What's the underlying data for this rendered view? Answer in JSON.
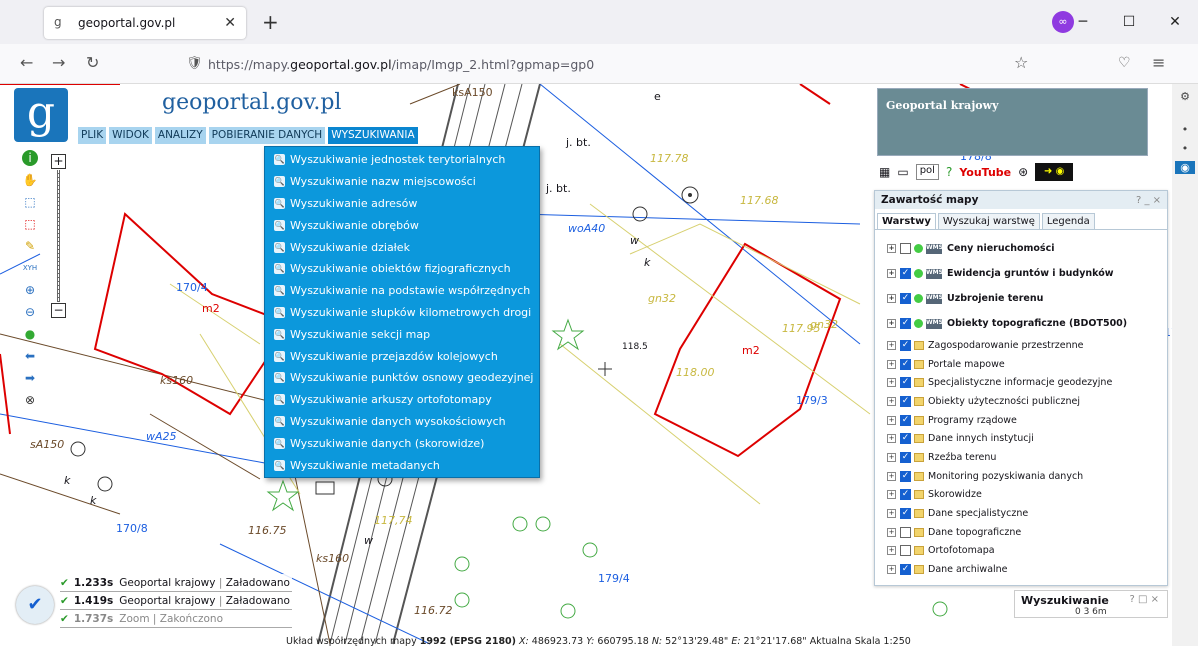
{
  "browser": {
    "tab_title": "geoportal.gov.pl",
    "url_prefix": "https://mapy.",
    "url_domain": "geoportal.gov.pl",
    "url_rest": "/imap/Imgp_2.html?gpmap=gp0"
  },
  "site": {
    "brand": "geoportal.gov.pl"
  },
  "menu": [
    "PLIK",
    "WIDOK",
    "ANALIZY",
    "POBIERANIE DANYCH",
    "WYSZUKIWANIA"
  ],
  "dropdown": [
    "Wyszukiwanie jednostek terytorialnych",
    "Wyszukiwanie nazw miejscowości",
    "Wyszukiwanie adresów",
    "Wyszukiwanie obrębów",
    "Wyszukiwanie działek",
    "Wyszukiwanie obiektów fizjograficznych",
    "Wyszukiwanie na podstawie współrzędnych",
    "Wyszukiwanie słupków kilometrowych drogi",
    "Wyszukiwanie sekcji map",
    "Wyszukiwanie przejazdów kolejowych",
    "Wyszukiwanie punktów osnowy geodezyjnej",
    "Wyszukiwanie arkuszy ortofotomapy",
    "Wyszukiwanie danych wysokościowych",
    "Wyszukiwanie danych (skorowidze)",
    "Wyszukiwanie metadanych"
  ],
  "rightpanel": {
    "overview_title": "Geoportal krajowy",
    "lang": "pol",
    "youtube": "YouTube"
  },
  "content": {
    "title": "Zawartość mapy",
    "controls": "? _ ×",
    "tabs": [
      "Warstwy",
      "Wyszukaj warstwę",
      "Legenda"
    ],
    "layers": [
      {
        "name": "Ceny nieruchomości",
        "on": false,
        "kind": "service"
      },
      {
        "name": "Ewidencja gruntów i budynków",
        "on": true,
        "kind": "service"
      },
      {
        "name": "Uzbrojenie terenu",
        "on": true,
        "kind": "service"
      },
      {
        "name": "Obiekty topograficzne (BDOT500)",
        "on": true,
        "kind": "service"
      },
      {
        "name": "Zagospodarowanie przestrzenne",
        "on": true,
        "kind": "folder"
      },
      {
        "name": "Portale mapowe",
        "on": true,
        "kind": "folder"
      },
      {
        "name": "Specjalistyczne informacje geodezyjne",
        "on": true,
        "kind": "folder"
      },
      {
        "name": "Obiekty użyteczności publicznej",
        "on": true,
        "kind": "folder"
      },
      {
        "name": "Programy rządowe",
        "on": true,
        "kind": "folder"
      },
      {
        "name": "Dane innych instytucji",
        "on": true,
        "kind": "folder"
      },
      {
        "name": "Rzeźba terenu",
        "on": true,
        "kind": "folder"
      },
      {
        "name": "Monitoring pozyskiwania danych",
        "on": true,
        "kind": "folder"
      },
      {
        "name": "Skorowidze",
        "on": true,
        "kind": "folder"
      },
      {
        "name": "Dane specjalistyczne",
        "on": true,
        "kind": "folder"
      },
      {
        "name": "Dane topograficzne",
        "on": false,
        "kind": "folder"
      },
      {
        "name": "Ortofotomapa",
        "on": false,
        "kind": "folder"
      },
      {
        "name": "Dane archiwalne",
        "on": true,
        "kind": "folder"
      }
    ]
  },
  "search": {
    "title": "Wyszukiwanie",
    "controls": "? □ ×",
    "scale": "0      3      6m"
  },
  "status": [
    {
      "time": "1.233s",
      "text": "Geoportal krajowy",
      "state": "Załadowano"
    },
    {
      "time": "1.419s",
      "text": "Geoportal krajowy",
      "state": "Załadowano"
    },
    {
      "time": "1.737s",
      "text": "Zoom",
      "state": "Zakończono"
    }
  ],
  "coords": {
    "label": "Układ współrzędnych mapy",
    "crs": "1992 (EPSG 2180)",
    "x": "486923.73",
    "y": "660795.18",
    "n": "52°13'29.48\"",
    "e": "21°21'17.68\"",
    "scale": "Aktualna Skala 1:250"
  },
  "map_labels": [
    "ksA150",
    "j. bt.",
    "j. bt.",
    "woA40",
    "gn32",
    "gn32",
    "117.78",
    "117.68",
    "117.95",
    "118.00",
    "118.5",
    "170/4",
    "m2",
    "m2",
    "179/3",
    "179/4",
    "170/8",
    "ks160",
    "ks160",
    "wA25",
    "sA150",
    "116.75",
    "116.72",
    "117,74",
    "178/8",
    "178/6",
    "k",
    "k",
    "k",
    "w",
    "w",
    "e"
  ]
}
